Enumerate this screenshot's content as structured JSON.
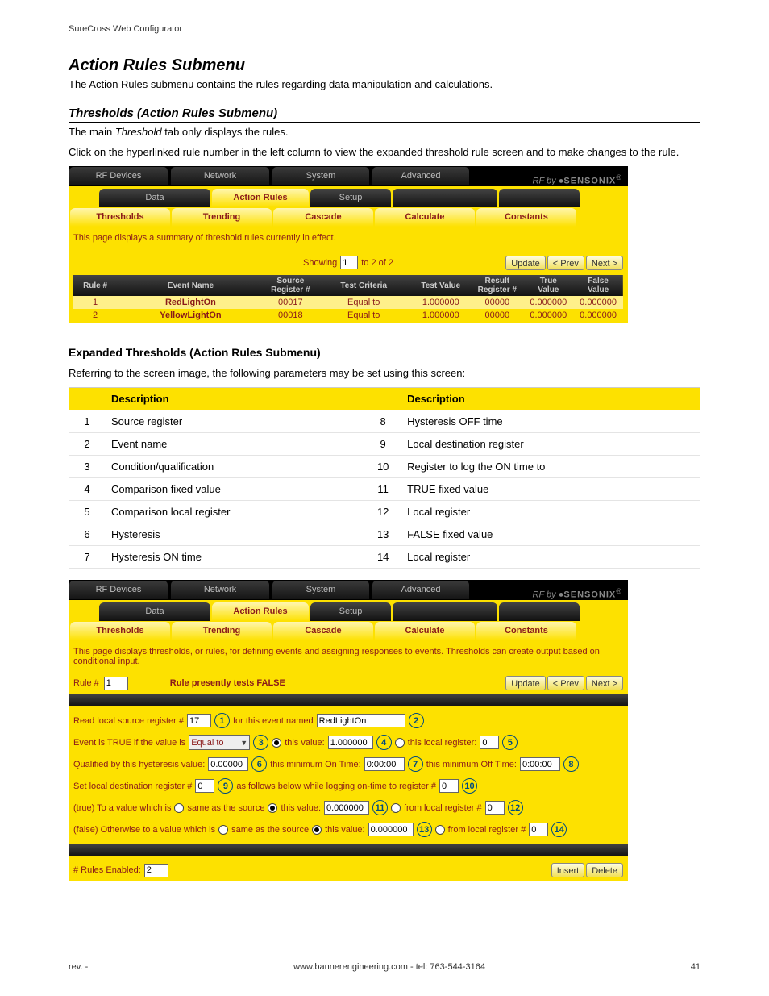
{
  "header": "SureCross Web Configurator",
  "title": "Action Rules Submenu",
  "intro": "The Action Rules submenu contains the rules regarding data manipulation and calculations.",
  "sub1_title": "Thresholds (Action Rules Submenu)",
  "sub1_p1a": "The main ",
  "sub1_p1b": "Threshold",
  "sub1_p1c": " tab only displays the rules.",
  "sub1_p2": "Click on the hyperlinked rule number in the left column to view the expanded threshold rule screen and to make changes to the rule.",
  "tabs_row1": {
    "a": "RF Devices",
    "b": "Network",
    "c": "System",
    "d": "Advanced",
    "logo_a": "RF by ",
    "logo_b": "SENSONIX"
  },
  "tabs_row2": {
    "a": "Data",
    "b": "Action Rules",
    "c": "Setup"
  },
  "tabs_row3": {
    "a": "Thresholds",
    "b": "Trending",
    "c": "Cascade",
    "d": "Calculate",
    "e": "Constants"
  },
  "ui1": {
    "desc": "This page displays a summary of threshold rules currently in effect.",
    "showing": "Showing",
    "show_val": "1",
    "to": "to 2 of 2",
    "upd": "Update",
    "prev": "< Prev",
    "next": "Next >",
    "cols": {
      "rule": "Rule #",
      "event": "Event Name",
      "src": "Source\nRegister #",
      "crit": "Test Criteria",
      "tval": "Test Value",
      "res": "Result\nRegister #",
      "tv": "True\nValue",
      "fv": "False\nValue"
    },
    "rows": [
      {
        "n": "1",
        "evt": "RedLightOn",
        "src": "00017",
        "crit": "Equal to",
        "tv": "1.000000",
        "rr": "00000",
        "tvv": "0.000000",
        "fvv": "0.000000"
      },
      {
        "n": "2",
        "evt": "YellowLightOn",
        "src": "00018",
        "crit": "Equal to",
        "tv": "1.000000",
        "rr": "00000",
        "tvv": "0.000000",
        "fvv": "0.000000"
      }
    ]
  },
  "sect2": "Expanded Thresholds (Action Rules Submenu)",
  "sect2_p": "Referring to the screen image, the following parameters may be set using this screen:",
  "desc_tbl": {
    "hdr": "Description",
    "left": [
      {
        "n": "1",
        "t": "Source register"
      },
      {
        "n": "2",
        "t": "Event name"
      },
      {
        "n": "3",
        "t": "Condition/qualification"
      },
      {
        "n": "4",
        "t": "Comparison fixed value"
      },
      {
        "n": "5",
        "t": "Comparison local register"
      },
      {
        "n": "6",
        "t": "Hysteresis"
      },
      {
        "n": "7",
        "t": "Hysteresis ON time"
      }
    ],
    "right": [
      {
        "n": "8",
        "t": "Hysteresis OFF time"
      },
      {
        "n": "9",
        "t": "Local destination register"
      },
      {
        "n": "10",
        "t": "Register to log the ON time to"
      },
      {
        "n": "11",
        "t": "TRUE fixed value"
      },
      {
        "n": "12",
        "t": "Local register"
      },
      {
        "n": "13",
        "t": "FALSE fixed value"
      },
      {
        "n": "14",
        "t": "Local register"
      }
    ]
  },
  "ui2": {
    "desc": "This page displays thresholds, or rules, for defining events and assigning responses to events. Thresholds can create output based on conditional input.",
    "rule_lbl": "Rule #",
    "rule_val": "1",
    "rule_status": "Rule presently tests FALSE",
    "upd": "Update",
    "prev": "< Prev",
    "next": "Next >",
    "l1a": "Read local source register #",
    "l1_inp": "17",
    "l1b": "for this event named",
    "l1_name": "RedLightOn",
    "l2a": "Event is TRUE if the value is",
    "l2_sel": "Equal to",
    "l2b": "this value:",
    "l2_v": "1.000000",
    "l2c": "this local register:",
    "l2_r": "0",
    "l3a": "Qualified by this hysteresis value:",
    "l3_v": "0.00000",
    "l3b": "this minimum On Time:",
    "l3_t1": "0:00:00",
    "l3c": "this minimum Off Time:",
    "l3_t2": "0:00:00",
    "l4a": "Set local destination register #",
    "l4_v": "0",
    "l4b": "as follows below while logging on-time to register #",
    "l4_r": "0",
    "l5a": "(true) To a value which is",
    "l5b": "same as the source",
    "l5c": "this value:",
    "l5_v": "0.000000",
    "l5d": "from local register #",
    "l5_r": "0",
    "l6a": "(false) Otherwise to a value which is",
    "l6b": "same as the source",
    "l6c": "this value:",
    "l6_v": "0.000000",
    "l6d": "from local register #",
    "l6_r": "0",
    "rules_enabled_lbl": "# Rules Enabled:",
    "rules_enabled_v": "2",
    "ins": "Insert",
    "del": "Delete"
  },
  "footer": {
    "rev": "rev. -",
    "url": "www.bannerengineering.com - tel: 763-544-3164",
    "pg": "41"
  }
}
